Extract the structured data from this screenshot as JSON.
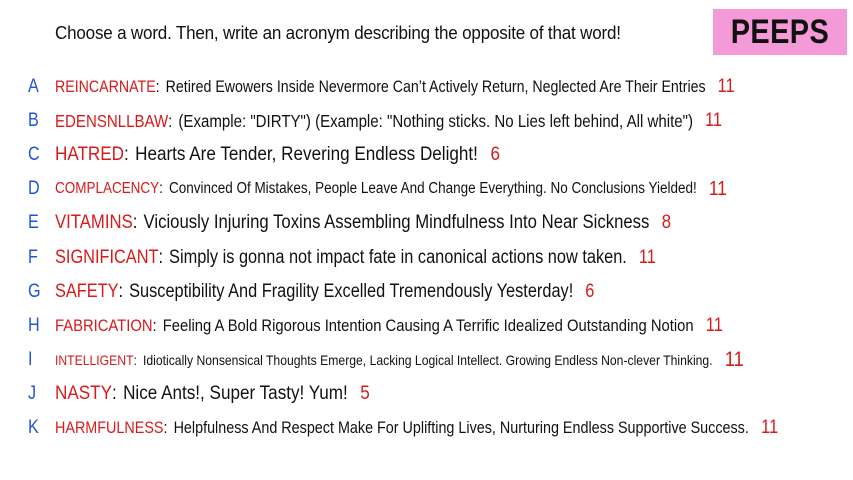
{
  "prompt": "Choose a word. Then, write an acronym describing the opposite of that word!",
  "badge": "PEEPS",
  "rows": [
    {
      "letter": "A",
      "word": "REINCARNATE",
      "phrase": "Retired Ewowers Inside Nevermore Can’t Actively Return, Neglected Are Their Entries",
      "score": "11"
    },
    {
      "letter": "B",
      "word": "EDENSNLLBAW",
      "phrase": "(Example: \"DIRTY\") (Example: \"Nothing sticks. No Lies left behind, All white\")",
      "score": "11"
    },
    {
      "letter": "C",
      "word": "HATRED",
      "phrase": "Hearts Are Tender, Revering Endless Delight!",
      "score": "6"
    },
    {
      "letter": "D",
      "word": "COMPLACENCY",
      "phrase": "Convinced Of Mistakes, People Leave And Change Everything. No Conclusions Yielded!",
      "score": "11"
    },
    {
      "letter": "E",
      "word": "VITAMINS",
      "phrase": "Viciously Injuring Toxins Assembling Mindfulness Into Near Sickness",
      "score": "8"
    },
    {
      "letter": "F",
      "word": "SIGNIFICANT",
      "phrase": "Simply is gonna not impact fate in canonical actions now taken.",
      "score": "11"
    },
    {
      "letter": "G",
      "word": "SAFETY",
      "phrase": "Susceptibility And Fragility Excelled Tremendously Yesterday!",
      "score": "6"
    },
    {
      "letter": "H",
      "word": "FABRICATION",
      "phrase": "Feeling A Bold Rigorous Intention Causing A Terrific Idealized Outstanding Notion",
      "score": "11"
    },
    {
      "letter": "I",
      "word": "INTELLIGENT",
      "phrase": "Idiotically Nonsensical Thoughts Emerge, Lacking Logical Intellect. Growing Endless Non-clever Thinking.",
      "score": "11"
    },
    {
      "letter": "J",
      "word": "NASTY",
      "phrase": "Nice Ants!, Super Tasty! Yum!",
      "score": "5"
    },
    {
      "letter": "K",
      "word": "HARMFULNESS",
      "phrase": "Helpfulness And Respect Make For Uplifting Lives, Nurturing Endless Supportive Success.",
      "score": "11"
    }
  ],
  "colors": {
    "badge_bg": "#f49ad7",
    "letter": "#1f55d8",
    "word": "#d81a1a",
    "score": "#d81a1a",
    "text": "#111111"
  }
}
